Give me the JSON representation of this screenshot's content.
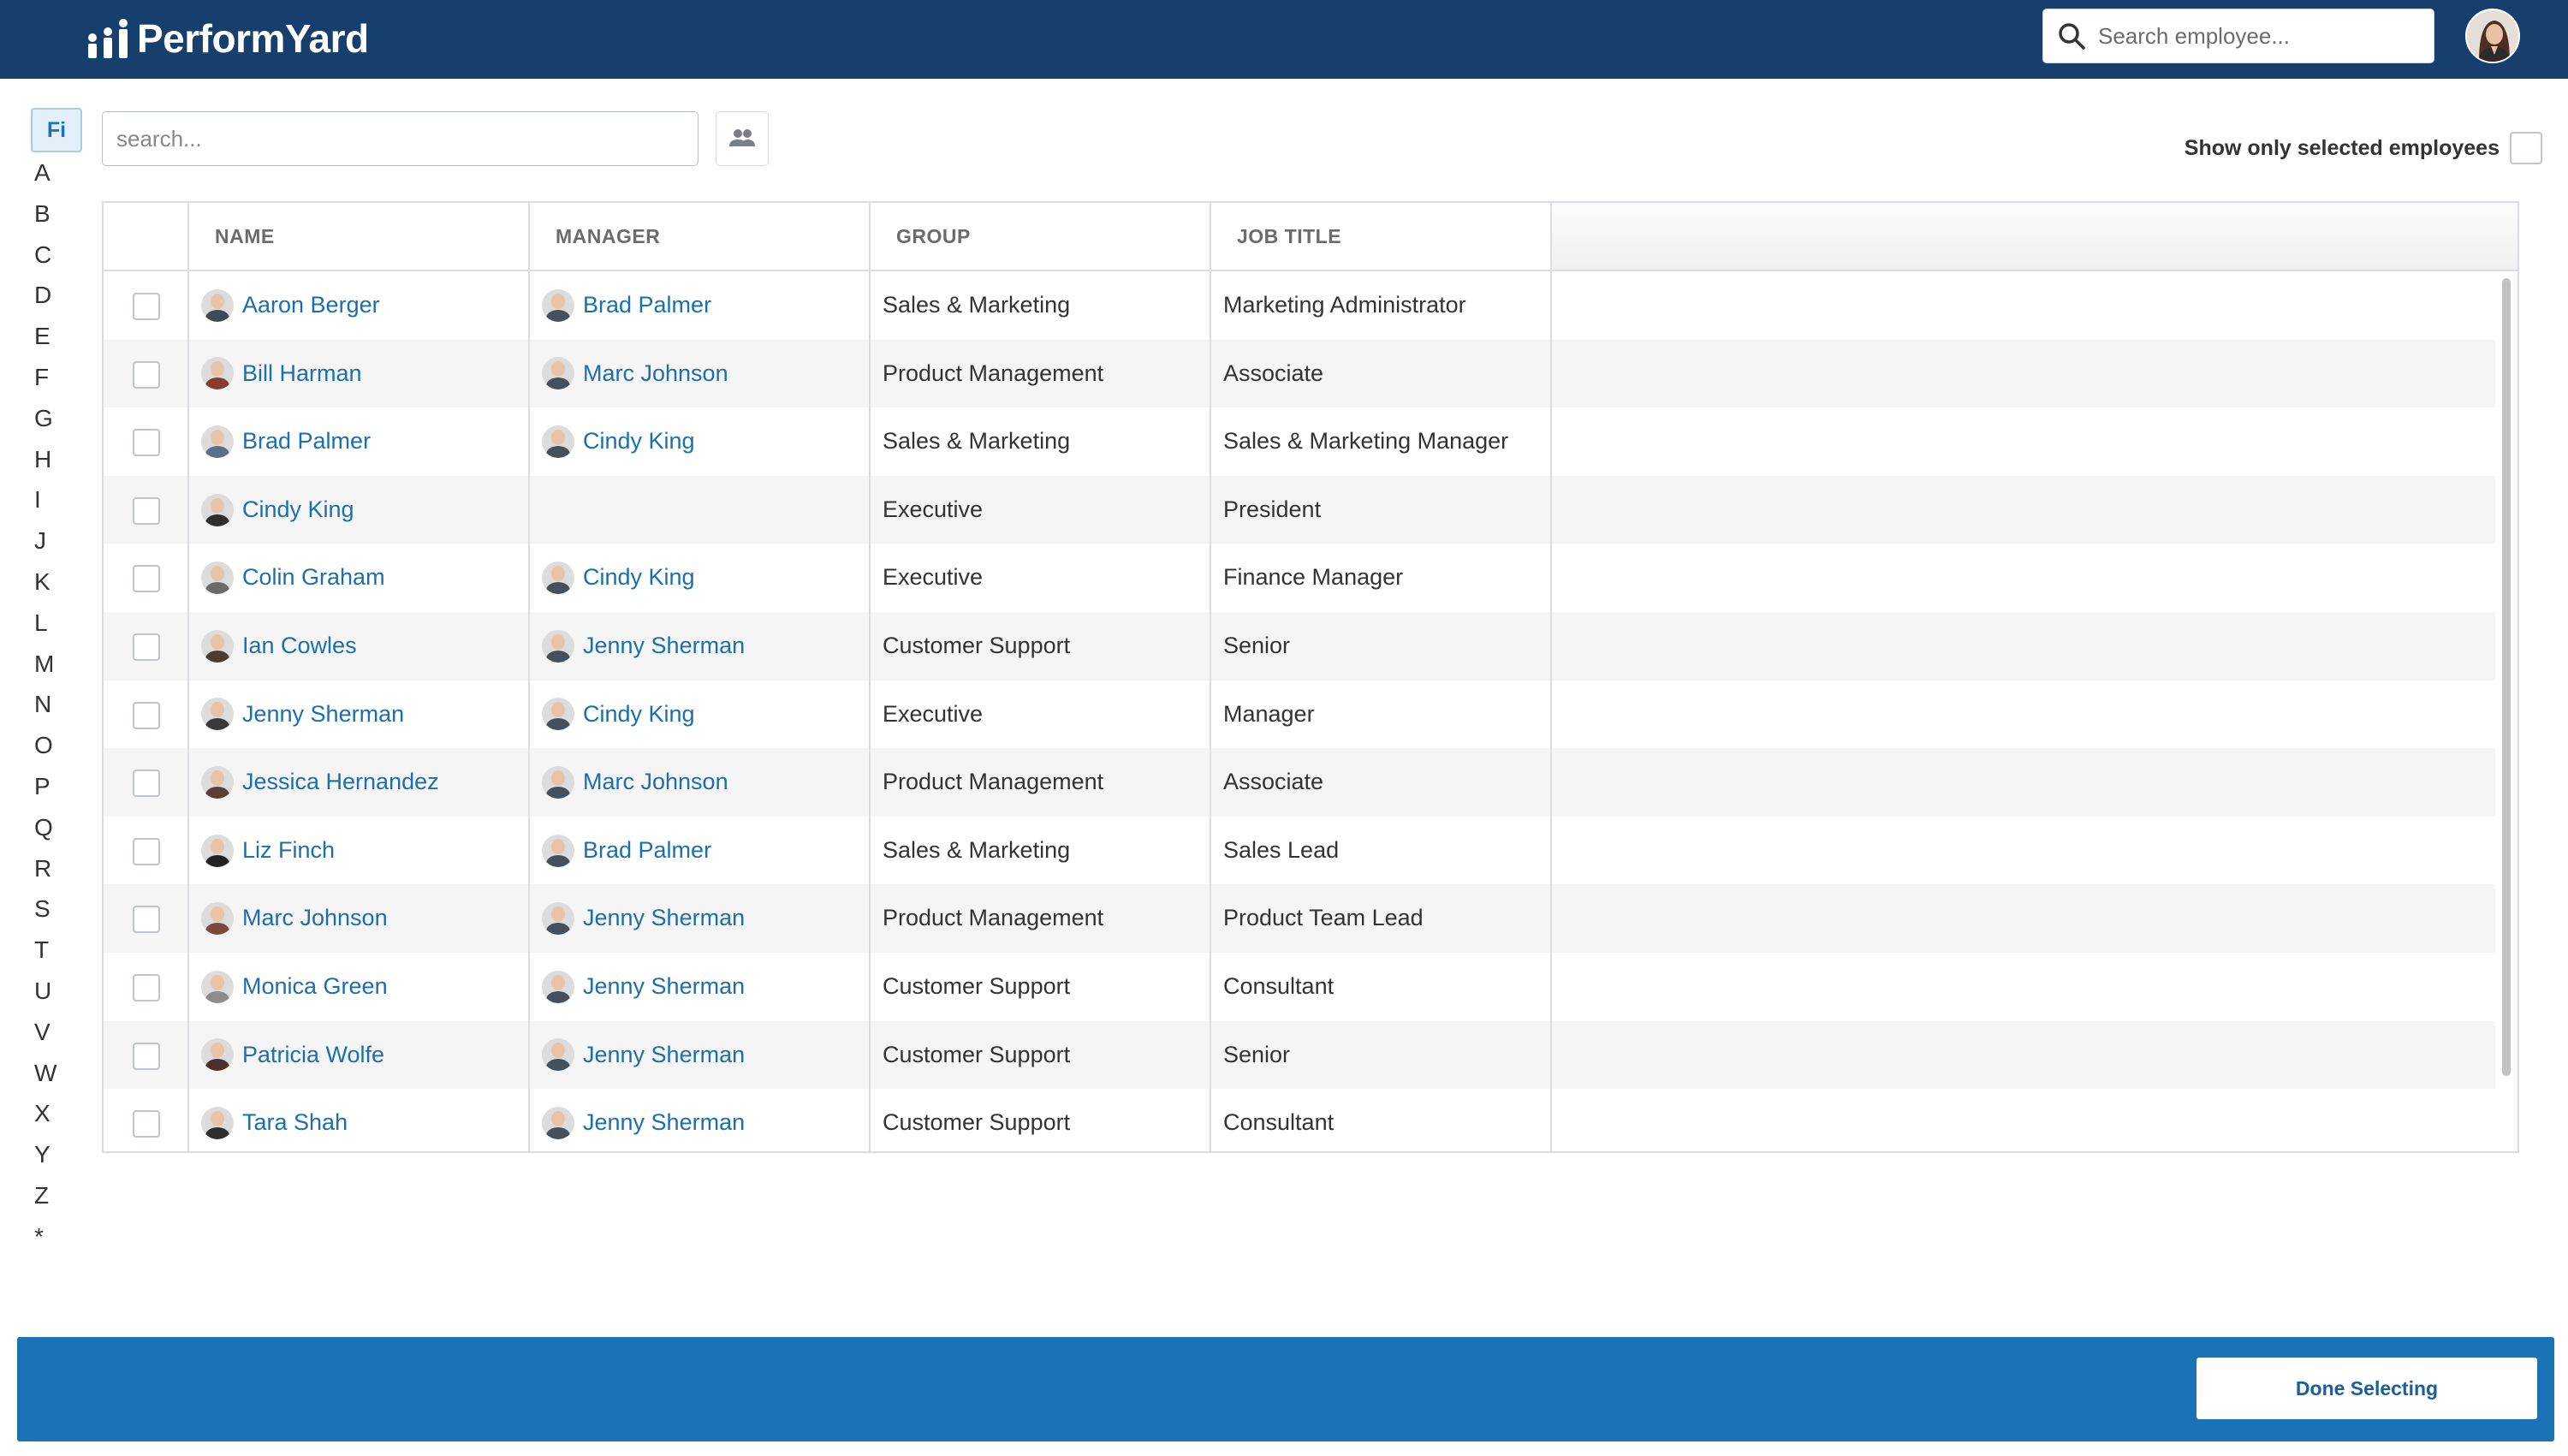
{
  "app": {
    "name": "PerformYard"
  },
  "header": {
    "search_placeholder": "Search employee..."
  },
  "alphabet": {
    "first_label": "Fi",
    "letters": [
      "A",
      "B",
      "C",
      "D",
      "E",
      "F",
      "G",
      "H",
      "I",
      "J",
      "K",
      "L",
      "M",
      "N",
      "O",
      "P",
      "Q",
      "R",
      "S",
      "T",
      "U",
      "V",
      "W",
      "X",
      "Y",
      "Z",
      "*"
    ]
  },
  "filter": {
    "search_placeholder": "search...",
    "show_selected_label": "Show only selected employees"
  },
  "table": {
    "columns": [
      "NAME",
      "MANAGER",
      "GROUP",
      "JOB TITLE"
    ],
    "rows": [
      {
        "name": "Aaron Berger",
        "manager": "Brad Palmer",
        "group": "Sales & Marketing",
        "job_title": "Marketing Administrator"
      },
      {
        "name": "Bill Harman",
        "manager": "Marc Johnson",
        "group": "Product Management",
        "job_title": "Associate"
      },
      {
        "name": "Brad Palmer",
        "manager": "Cindy King",
        "group": "Sales & Marketing",
        "job_title": "Sales & Marketing Manager"
      },
      {
        "name": "Cindy King",
        "manager": "",
        "group": "Executive",
        "job_title": "President"
      },
      {
        "name": "Colin Graham",
        "manager": "Cindy King",
        "group": "Executive",
        "job_title": "Finance Manager"
      },
      {
        "name": "Ian Cowles",
        "manager": "Jenny Sherman",
        "group": "Customer Support",
        "job_title": "Senior"
      },
      {
        "name": "Jenny Sherman",
        "manager": "Cindy King",
        "group": "Executive",
        "job_title": "Manager"
      },
      {
        "name": "Jessica Hernandez",
        "manager": "Marc Johnson",
        "group": "Product Management",
        "job_title": "Associate"
      },
      {
        "name": "Liz Finch",
        "manager": "Brad Palmer",
        "group": "Sales & Marketing",
        "job_title": "Sales Lead"
      },
      {
        "name": "Marc Johnson",
        "manager": "Jenny Sherman",
        "group": "Product Management",
        "job_title": "Product Team Lead"
      },
      {
        "name": "Monica Green",
        "manager": "Jenny Sherman",
        "group": "Customer Support",
        "job_title": "Consultant"
      },
      {
        "name": "Patricia Wolfe",
        "manager": "Jenny Sherman",
        "group": "Customer Support",
        "job_title": "Senior"
      },
      {
        "name": "Tara Shah",
        "manager": "Jenny Sherman",
        "group": "Customer Support",
        "job_title": "Consultant"
      }
    ]
  },
  "footer": {
    "done_label": "Done Selecting"
  },
  "colors": {
    "topbar": "#173f6e",
    "footer": "#1a73b4",
    "link": "#1a6fae"
  },
  "icons": [
    "performyard-logo-icon",
    "search-icon",
    "user-avatar",
    "group-icon"
  ]
}
